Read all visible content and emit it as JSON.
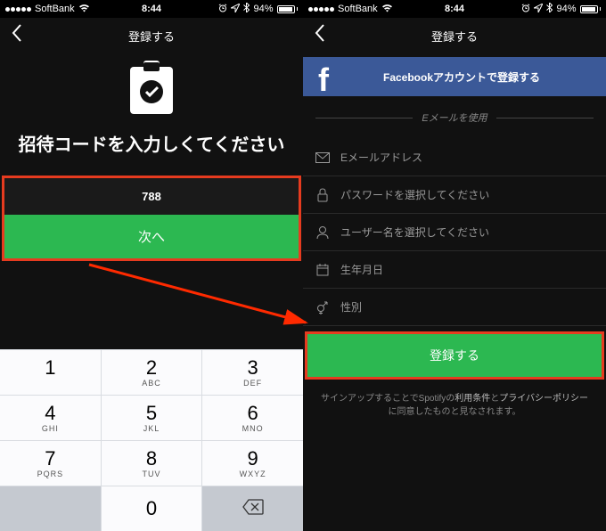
{
  "status": {
    "carrier": "SoftBank",
    "time": "8:44",
    "battery_pct": "94%"
  },
  "left": {
    "nav_title": "登録する",
    "heading": "招待コードを入力しくてください",
    "code_value": "788",
    "next_label": "次へ",
    "keypad": {
      "k1": "1",
      "k2": "2",
      "k3": "3",
      "k4": "4",
      "k5": "5",
      "k6": "6",
      "k7": "7",
      "k8": "8",
      "k9": "9",
      "k0": "0",
      "l2": "ABC",
      "l3": "DEF",
      "l4": "GHI",
      "l5": "JKL",
      "l6": "MNO",
      "l7": "PQRS",
      "l8": "TUV",
      "l9": "WXYZ"
    }
  },
  "right": {
    "nav_title": "登録する",
    "fb_label": "Facebookアカウントで登録する",
    "divider_label": "Eメールを使用",
    "fields": {
      "email": "Eメールアドレス",
      "password": "パスワードを選択してください",
      "username": "ユーザー名を選択してください",
      "dob": "生年月日",
      "gender": "性別"
    },
    "register_label": "登録する",
    "fine_print_1": "サインアップすることでSpotifyの",
    "terms": "利用条件",
    "and": "と",
    "privacy": "プライバシーポリシー",
    "fine_print_2": "に同意したものと見なされます。"
  }
}
